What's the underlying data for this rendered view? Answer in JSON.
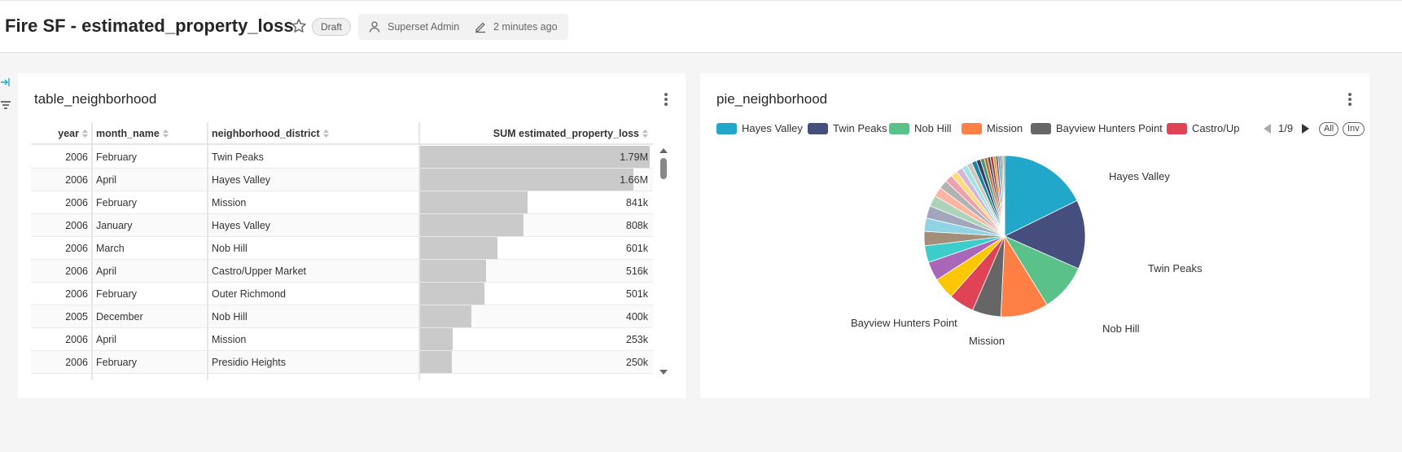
{
  "header": {
    "title": "Fire SF - estimated_property_loss",
    "status_badge": "Draft",
    "owner": "Superset Admin",
    "modified": "2 minutes ago"
  },
  "table_chart": {
    "title": "table_neighborhood",
    "columns": [
      "year",
      "month_name",
      "neighborhood_district",
      "SUM estimated_property_loss"
    ],
    "max_value": 1790000,
    "rows": [
      {
        "year": "2006",
        "month": "February",
        "neighborhood": "Twin Peaks",
        "value": 1790000,
        "label": "1.79M"
      },
      {
        "year": "2006",
        "month": "April",
        "neighborhood": "Hayes Valley",
        "value": 1660000,
        "label": "1.66M"
      },
      {
        "year": "2006",
        "month": "February",
        "neighborhood": "Mission",
        "value": 841000,
        "label": "841k"
      },
      {
        "year": "2006",
        "month": "January",
        "neighborhood": "Hayes Valley",
        "value": 808000,
        "label": "808k"
      },
      {
        "year": "2006",
        "month": "March",
        "neighborhood": "Nob Hill",
        "value": 601000,
        "label": "601k"
      },
      {
        "year": "2006",
        "month": "April",
        "neighborhood": "Castro/Upper Market",
        "value": 516000,
        "label": "516k"
      },
      {
        "year": "2006",
        "month": "February",
        "neighborhood": "Outer Richmond",
        "value": 501000,
        "label": "501k"
      },
      {
        "year": "2005",
        "month": "December",
        "neighborhood": "Nob Hill",
        "value": 400000,
        "label": "400k"
      },
      {
        "year": "2006",
        "month": "April",
        "neighborhood": "Mission",
        "value": 253000,
        "label": "253k"
      },
      {
        "year": "2006",
        "month": "February",
        "neighborhood": "Presidio Heights",
        "value": 250000,
        "label": "250k"
      }
    ]
  },
  "pie_chart": {
    "title": "pie_neighborhood",
    "legend": [
      {
        "name": "Hayes Valley",
        "color": "#20a7c9"
      },
      {
        "name": "Twin Peaks",
        "color": "#454e7c"
      },
      {
        "name": "Nob Hill",
        "color": "#5ac189"
      },
      {
        "name": "Mission",
        "color": "#ff7f44"
      },
      {
        "name": "Bayview Hunters Point",
        "color": "#666666"
      },
      {
        "name": "Castro/Up",
        "color": "#e04355"
      }
    ],
    "legend_page": "1/9",
    "legend_all": "All",
    "legend_inv": "Inv",
    "slice_labels": [
      "Hayes Valley",
      "Twin Peaks",
      "Nob Hill",
      "Mission",
      "Bayview Hunters Point"
    ]
  },
  "chart_data": {
    "type": "pie",
    "slices": [
      {
        "name": "Hayes Valley",
        "value": 18.5,
        "color": "#20a7c9"
      },
      {
        "name": "Twin Peaks",
        "value": 14.5,
        "color": "#454e7c"
      },
      {
        "name": "Nob Hill",
        "value": 10.0,
        "color": "#5ac189"
      },
      {
        "name": "Mission",
        "value": 10.0,
        "color": "#ff7f44"
      },
      {
        "name": "Bayview Hunters Point",
        "value": 6.0,
        "color": "#666666"
      },
      {
        "name": "Castro/Upper Market",
        "value": 5.3,
        "color": "#e04355"
      },
      {
        "name": "",
        "value": 4.5,
        "color": "#fcc700"
      },
      {
        "name": "",
        "value": 4.0,
        "color": "#a868b7"
      },
      {
        "name": "",
        "value": 3.5,
        "color": "#3ccccb"
      },
      {
        "name": "",
        "value": 3.0,
        "color": "#a38f79"
      },
      {
        "name": "",
        "value": 2.8,
        "color": "#8fd3e4"
      },
      {
        "name": "",
        "value": 2.6,
        "color": "#a1a6bd"
      },
      {
        "name": "",
        "value": 2.3,
        "color": "#acd3b9"
      },
      {
        "name": "",
        "value": 2.0,
        "color": "#feb5a1"
      },
      {
        "name": "",
        "value": 1.8,
        "color": "#b2b2b2"
      },
      {
        "name": "",
        "value": 1.6,
        "color": "#efa1aa"
      },
      {
        "name": "",
        "value": 1.4,
        "color": "#fddc7f"
      },
      {
        "name": "",
        "value": 1.3,
        "color": "#d3b4dc"
      },
      {
        "name": "",
        "value": 1.2,
        "color": "#9ee5e5"
      },
      {
        "name": "",
        "value": 1.1,
        "color": "#d1c6bc"
      },
      {
        "name": "",
        "value": 1.0,
        "color": "#1a85a0"
      },
      {
        "name": "",
        "value": 0.9,
        "color": "#373e63"
      },
      {
        "name": "",
        "value": 0.8,
        "color": "#489a6d"
      },
      {
        "name": "",
        "value": 0.7,
        "color": "#cc6536"
      },
      {
        "name": "",
        "value": 0.6,
        "color": "#515151"
      },
      {
        "name": "",
        "value": 0.6,
        "color": "#b33544"
      },
      {
        "name": "",
        "value": 0.5,
        "color": "#ca9f00"
      },
      {
        "name": "",
        "value": 0.5,
        "color": "#865392"
      },
      {
        "name": "",
        "value": 0.4,
        "color": "#30a3a2"
      },
      {
        "name": "",
        "value": 0.4,
        "color": "#827261"
      },
      {
        "name": "",
        "value": 0.3,
        "color": "#73a9b6"
      },
      {
        "name": "",
        "value": 0.3,
        "color": "#808597"
      }
    ]
  }
}
